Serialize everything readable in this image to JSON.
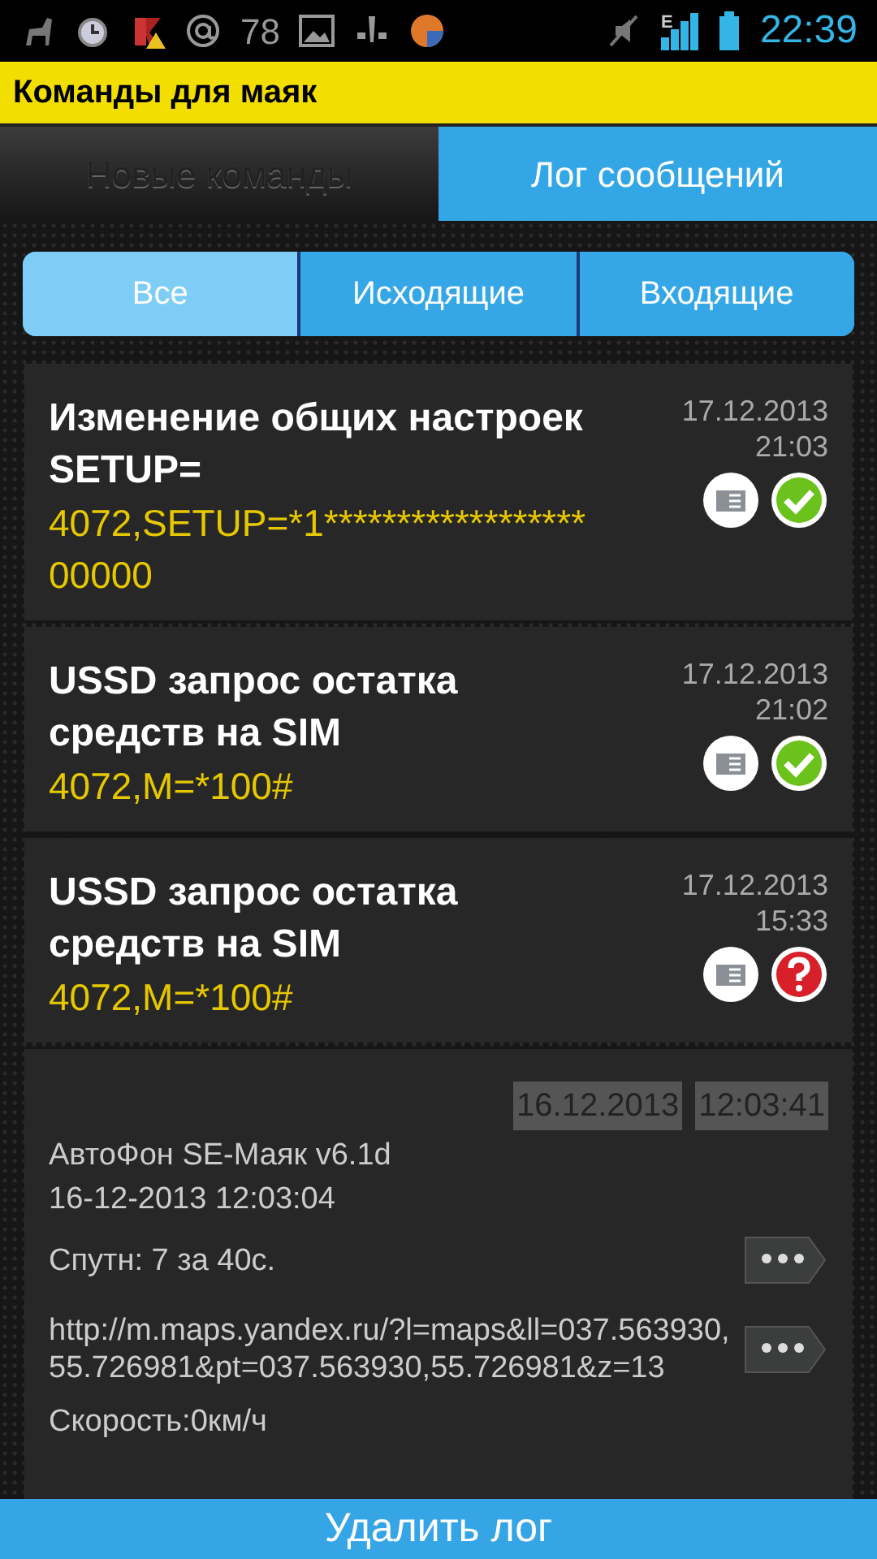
{
  "status_bar": {
    "notification_count": "78",
    "network": "E",
    "time": "22:39"
  },
  "title": "Команды для маяк",
  "tabs": [
    {
      "label": "Новые команды",
      "selected": false
    },
    {
      "label": "Лог сообщений",
      "selected": true
    }
  ],
  "filters": [
    {
      "label": "Все",
      "selected": true
    },
    {
      "label": "Исходящие",
      "selected": false
    },
    {
      "label": "Входящие",
      "selected": false
    }
  ],
  "messages": [
    {
      "kind": "outgoing",
      "title": "Изменение общих настроек SETUP=",
      "command": "4072,SETUP=*1******************00000",
      "date": "17.12.2013",
      "time": "21:03",
      "delivered": true
    },
    {
      "kind": "outgoing",
      "title": "USSD запрос остатка средств на SIM",
      "command": "4072,M=*100#",
      "date": "17.12.2013",
      "time": "21:02",
      "delivered": true
    },
    {
      "kind": "outgoing",
      "title": "USSD запрос остатка средств на SIM",
      "command": "4072,M=*100#",
      "date": "17.12.2013",
      "time": "15:33",
      "delivered": false
    },
    {
      "kind": "incoming",
      "date": "16.12.2013",
      "time": "12:03:41",
      "lines": [
        {
          "text": "АвтоФон SE-Маяк v6.1d",
          "more": false
        },
        {
          "text": "16-12-2013 12:03:04",
          "more": false
        },
        {
          "text": "Спутн: 7 за 40с.",
          "more": true
        },
        {
          "text": "http://m.maps.yandex.ru/?l=maps&ll=037.563930,55.726981&pt=037.563930,55.726981&z=13",
          "more": true
        },
        {
          "text": "Скорость:0км/ч",
          "more": false
        }
      ]
    }
  ],
  "delete_button": "Удалить лог"
}
